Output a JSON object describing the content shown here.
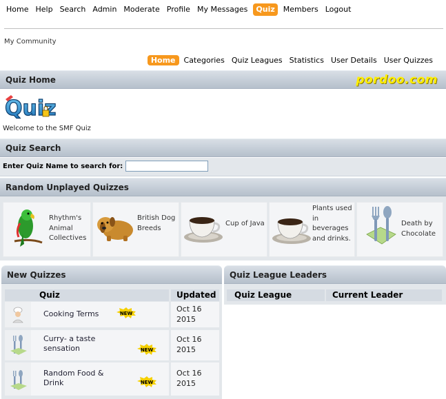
{
  "top_menu": [
    "Home",
    "Help",
    "Search",
    "Admin",
    "Moderate",
    "Profile",
    "My Messages",
    "Quiz",
    "Members",
    "Logout"
  ],
  "top_menu_active": "Quiz",
  "breadcrumb": "My Community",
  "sub_menu": [
    "Home",
    "Categories",
    "Quiz Leagues",
    "Statistics",
    "User Details",
    "User Quizzes"
  ],
  "sub_menu_active": "Home",
  "quiz_home": {
    "title": "Quiz Home",
    "brand": "pordoo.com",
    "welcome": "Welcome to the SMF Quiz",
    "logo_text": "Quiz"
  },
  "quiz_search": {
    "title": "Quiz Search",
    "label": "Enter Quiz Name to search for:",
    "value": "",
    "placeholder": ""
  },
  "random_unplayed": {
    "title": "Random Unplayed Quizzes",
    "items": [
      {
        "label": "Rhythm's Animal Collectives",
        "icon": "parrot-icon"
      },
      {
        "label": "British Dog Breeds",
        "icon": "dog-icon"
      },
      {
        "label": "Cup of Java",
        "icon": "coffee-cup-icon"
      },
      {
        "label": "Plants used in beverages and drinks.",
        "icon": "coffee-cup-icon"
      },
      {
        "label": "Death by Chocolate",
        "icon": "cutlery-icon"
      }
    ]
  },
  "new_quizzes": {
    "title": "New Quizzes",
    "col_quiz": "Quiz",
    "col_updated": "Updated",
    "badge": "NEW",
    "rows": [
      {
        "name": "Cooking Terms",
        "date": "Oct 16 2015",
        "icon": "chef-icon"
      },
      {
        "name": "Curry- a taste sensation",
        "date": "Oct 16 2015",
        "icon": "cutlery-icon"
      },
      {
        "name": "Random Food & Drink",
        "date": "Oct 16 2015",
        "icon": "cutlery-icon"
      }
    ]
  },
  "league_leaders": {
    "title": "Quiz League Leaders",
    "col_league": "Quiz League",
    "col_leader": "Current Leader"
  },
  "colors": {
    "accent": "#f7981d",
    "bar": "#c3ccd6",
    "panel": "#e3e7eb",
    "brand": "#ffee00"
  }
}
